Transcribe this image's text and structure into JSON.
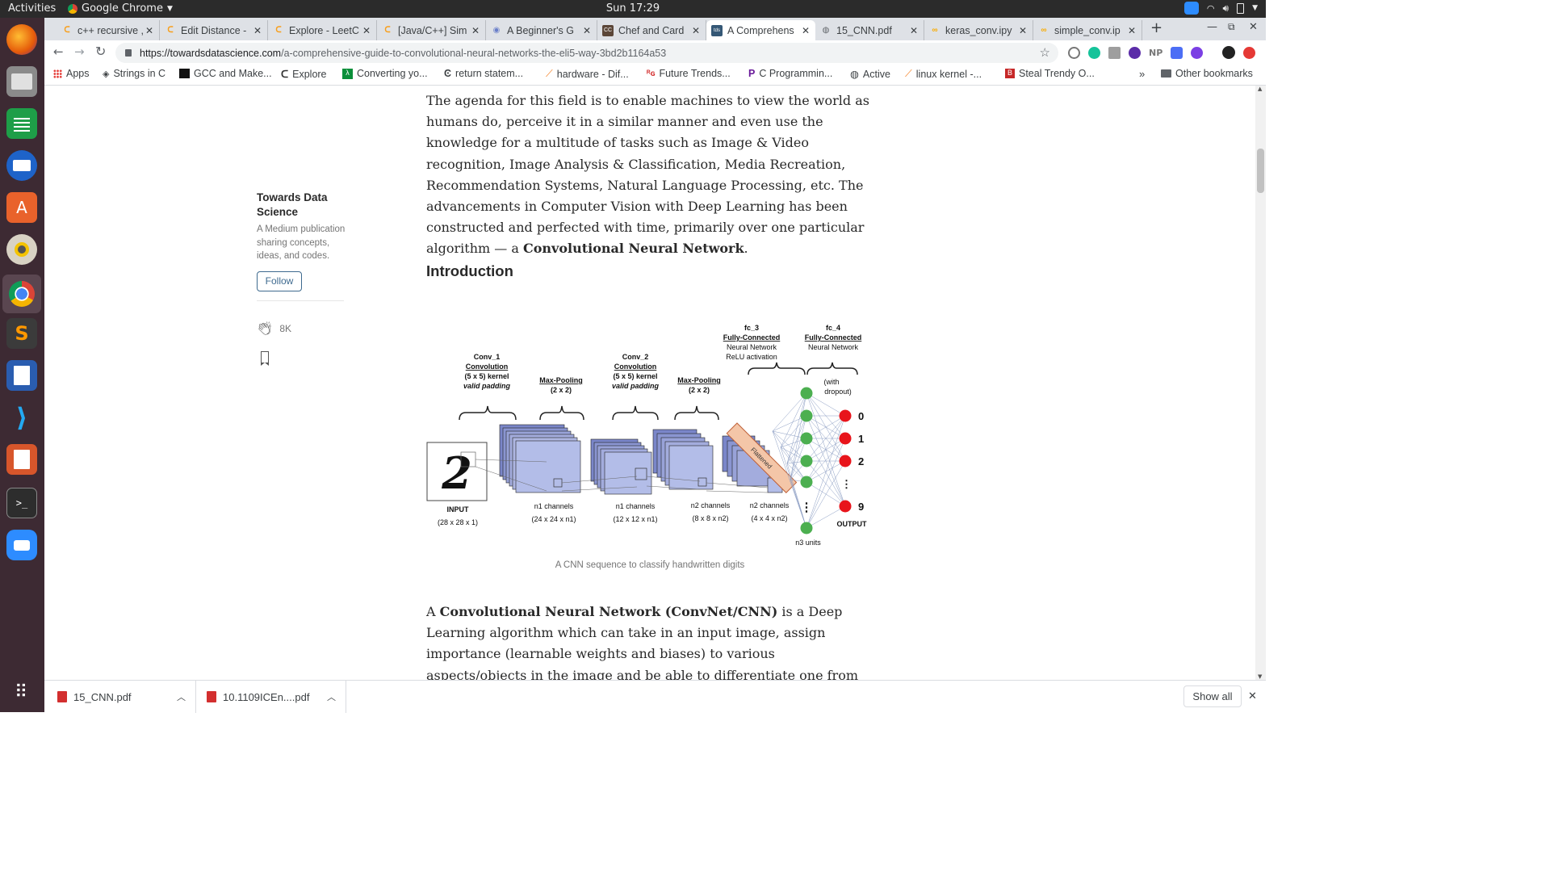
{
  "system": {
    "activities": "Activities",
    "app_name": "Google Chrome",
    "clock": "Sun 17:29"
  },
  "tabs": [
    {
      "label": "c++ recursive ,",
      "active": false
    },
    {
      "label": "Edit Distance -",
      "active": false
    },
    {
      "label": "Explore - LeetC",
      "active": false
    },
    {
      "label": "[Java/C++] Sim",
      "active": false
    },
    {
      "label": "A Beginner's G",
      "active": false
    },
    {
      "label": "Chef and Card",
      "active": false
    },
    {
      "label": "A Comprehens",
      "active": true
    },
    {
      "label": "15_CNN.pdf",
      "active": false
    },
    {
      "label": "keras_conv.ipy",
      "active": false
    },
    {
      "label": "simple_conv.ip",
      "active": false
    }
  ],
  "address": {
    "host": "https://towardsdatascience.com",
    "path": "/a-comprehensive-guide-to-convolutional-neural-networks-the-eli5-way-3bd2b1164a53"
  },
  "bookmarks": [
    "Apps",
    "Strings in C",
    "GCC and Make...",
    "Explore",
    "Converting yo...",
    "return statem...",
    "hardware - Dif...",
    "Future Trends...",
    "C Programmin...",
    "Active",
    "linux kernel -...",
    "Steal Trendy O..."
  ],
  "other_bookmarks": "Other bookmarks",
  "sidebar": {
    "publication": "Towards Data Science",
    "description": "A Medium publication sharing concepts, ideas, and codes.",
    "follow": "Follow",
    "claps": "8K"
  },
  "article": {
    "para1_before": "The agenda for this field is to enable machines to view the world as humans do, perceive it in a similar manner and even use the knowledge for a multitude of tasks such as Image & Video recognition, Image Analysis & Classification, Media Recreation, Recommendation Systems, Natural Language Processing, etc. The advancements in Computer Vision with Deep Learning has been constructed and perfected with time, primarily over one particular algorithm — a ",
    "para1_bold": "Convolutional Neural Network",
    "para1_after": ".",
    "heading": "Introduction",
    "caption": "A CNN sequence to classify handwritten digits",
    "para2_before": "A ",
    "para2_bold": "Convolutional Neural Network (ConvNet/CNN)",
    "para2_after": " is a Deep Learning algorithm which can take in an input image, assign importance (learnable weights and biases) to various aspects/objects in the image and be able to differentiate one from the other. The pre-processing required in a ConvNet"
  },
  "diagram": {
    "conv1": [
      "Conv_1",
      "Convolution",
      "(5 x 5) kernel",
      "valid padding"
    ],
    "pool1": [
      "Max-Pooling",
      "(2 x 2)"
    ],
    "conv2": [
      "Conv_2",
      "Convolution",
      "(5 x 5) kernel",
      "valid padding"
    ],
    "pool2": [
      "Max-Pooling",
      "(2 x 2)"
    ],
    "fc3": [
      "fc_3",
      "Fully-Connected",
      "Neural Network",
      "ReLU activation"
    ],
    "fc4": [
      "fc_4",
      "Fully-Connected",
      "Neural Network"
    ],
    "dropout": [
      "(with",
      "dropout)"
    ],
    "input": [
      "INPUT",
      "(28 x 28 x 1)"
    ],
    "layer1": [
      "n1 channels",
      "(24 x 24 x n1)"
    ],
    "layer2": [
      "n1 channels",
      "(12 x 12 x n1)"
    ],
    "layer3": [
      "n2 channels",
      "(8 x 8 x n2)"
    ],
    "layer4": [
      "n2 channels",
      "(4 x 4 x n2)"
    ],
    "flattened": "Flattened",
    "n3units": "n3 units",
    "output": "OUTPUT",
    "digits": [
      "0",
      "1",
      "2",
      "⋮",
      "9"
    ],
    "input_digit": "2"
  },
  "downloads": [
    {
      "name": "15_CNN.pdf"
    },
    {
      "name": "10.1109ICEn....pdf"
    }
  ],
  "download_show_all": "Show all",
  "colors": {
    "accent": "#1a73e8",
    "node_green": "#4caf50",
    "node_red": "#e8141b",
    "layer_blue": "#b3bde8"
  }
}
